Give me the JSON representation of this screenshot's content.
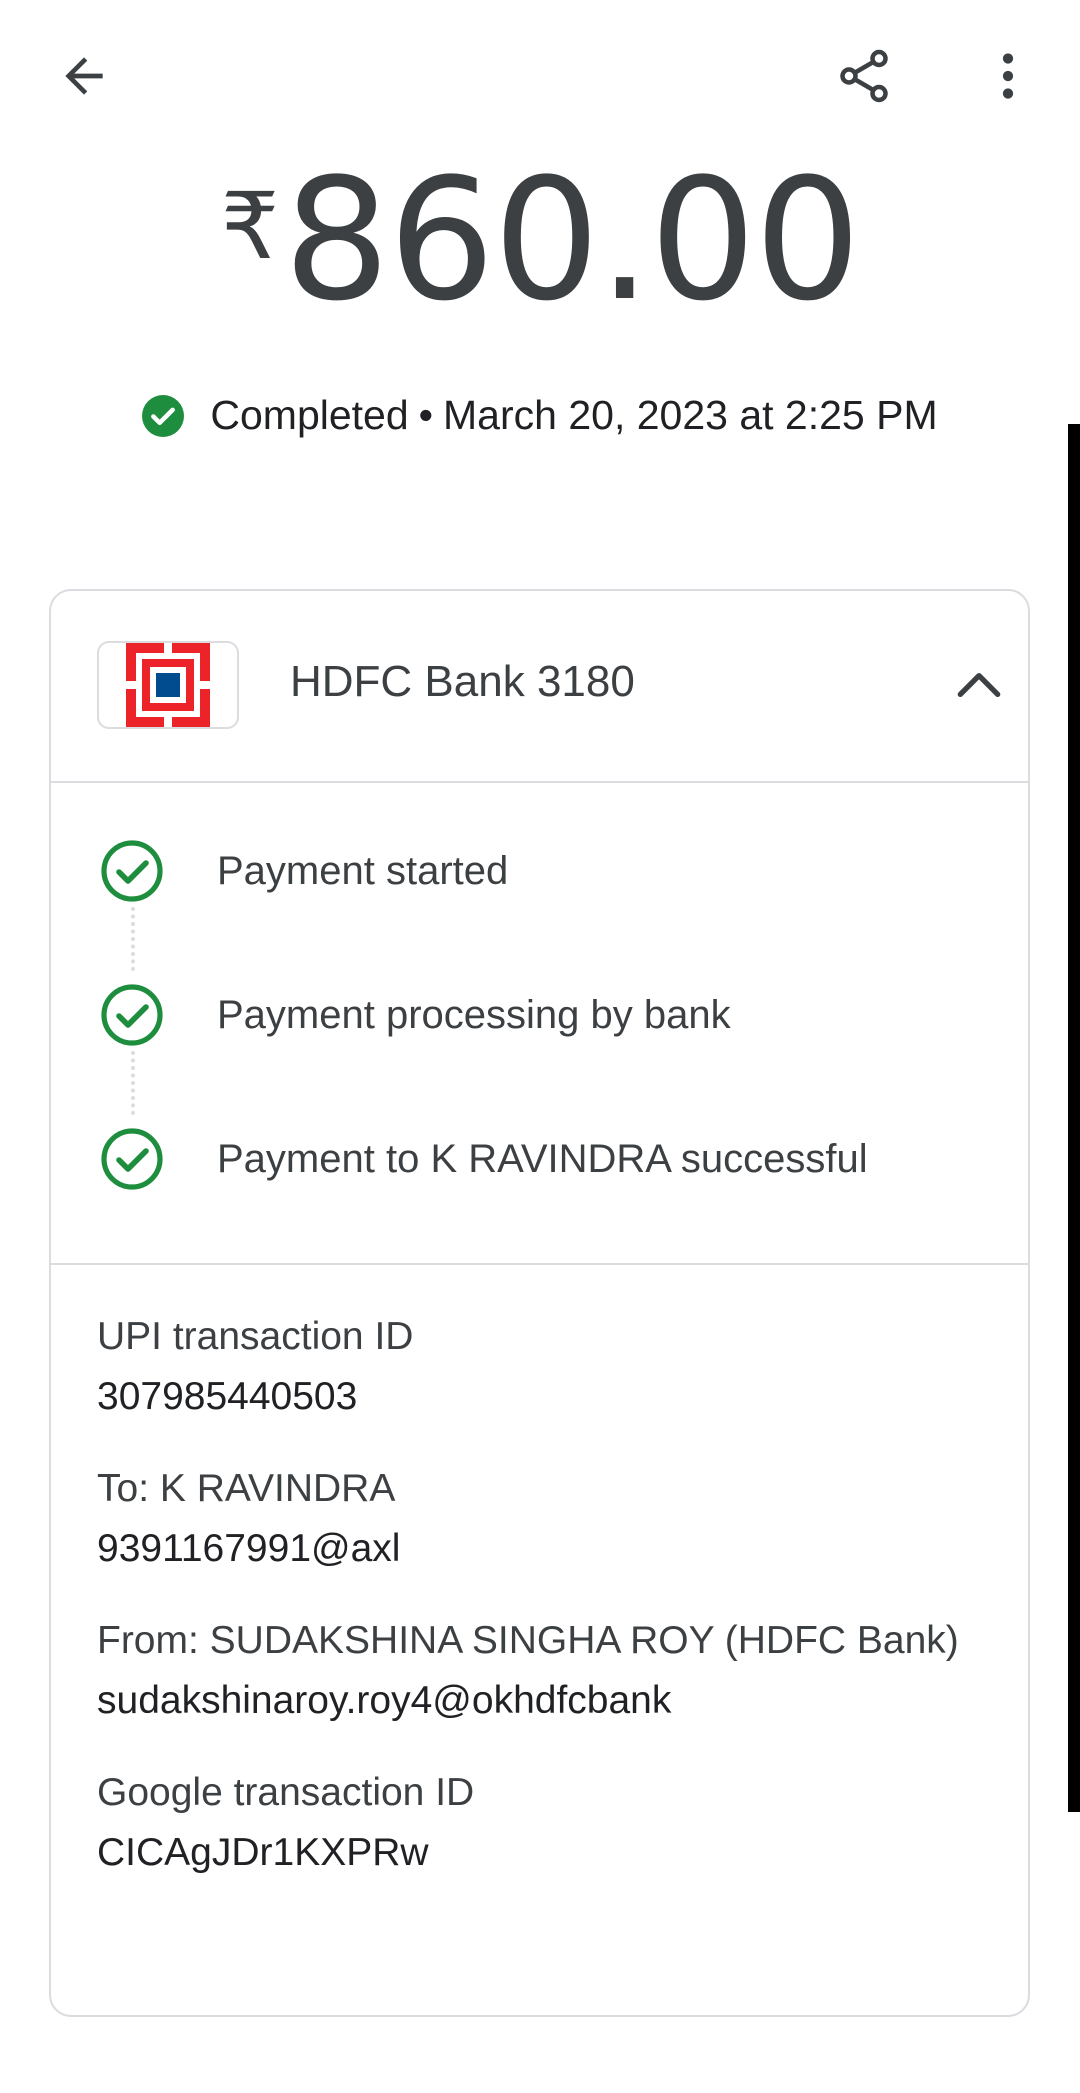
{
  "toolbar": {
    "back_icon": "arrow-back-icon",
    "share_icon": "share-icon",
    "more_icon": "more-vert-icon"
  },
  "payment": {
    "currency_symbol": "₹",
    "amount": "860.00",
    "status": "Completed",
    "separator": "•",
    "datetime": "March 20, 2023 at 2:25 PM"
  },
  "card": {
    "bank_name": "HDFC Bank 3180",
    "bank_logo": "hdfc-bank-logo",
    "toggle_icon": "chevron-up-icon"
  },
  "timeline": {
    "steps": [
      {
        "label": "Payment started"
      },
      {
        "label": "Payment processing by bank"
      },
      {
        "label": "Payment to K RAVINDRA successful"
      }
    ]
  },
  "details": {
    "upi_label": "UPI transaction ID",
    "upi_value": "307985440503",
    "to_label": "To: K RAVINDRA",
    "to_value": "9391167991@axl",
    "from_label": "From: SUDAKSHINA SINGHA ROY (HDFC Bank)",
    "from_value": "sudakshinaroy.roy4@okhdfcbank",
    "google_label": "Google transaction ID",
    "google_value": "CICAgJDr1KXPRw"
  },
  "colors": {
    "success_green": "#1e8e3e",
    "hdfc_red": "#ed232a",
    "hdfc_blue": "#004c8f",
    "border": "#dadce0",
    "text": "#3c4043"
  }
}
